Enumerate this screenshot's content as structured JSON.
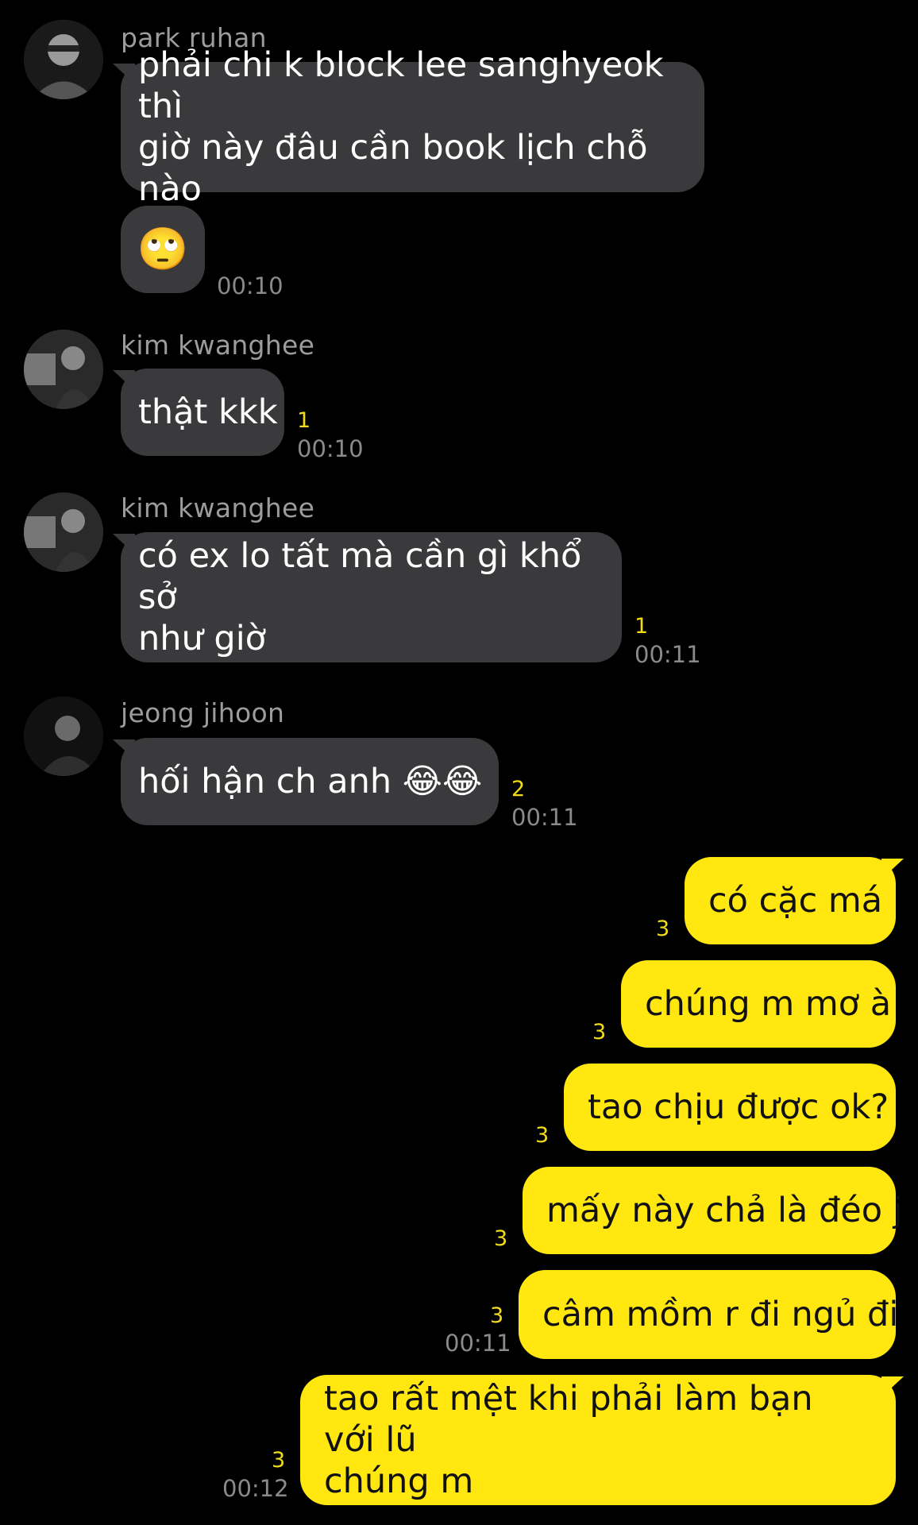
{
  "messages": [
    {
      "sender": "park ruhan",
      "text_lines": [
        "phải chi k block lee sanghyeok thì",
        "giờ này đâu cần book lịch chỗ nào"
      ]
    },
    {
      "emoji": "🙄",
      "time": "00:10"
    },
    {
      "sender": "kim kwanghee",
      "text": "thật kkk",
      "unread": "1",
      "time": "00:10"
    },
    {
      "sender": "kim kwanghee",
      "text_lines": [
        "có ex lo tất mà cần gì khổ sở",
        "như giờ"
      ],
      "unread": "1",
      "time": "00:11"
    },
    {
      "sender": "jeong jihoon",
      "text": "hối hận ch anh 😂😂",
      "unread": "2",
      "time": "00:11"
    },
    {
      "text": "có cặc má",
      "unread": "3"
    },
    {
      "text": "chúng m mơ à",
      "unread": "3"
    },
    {
      "text": "tao chịu được ok?",
      "unread": "3"
    },
    {
      "text": "mấy này chả là đéo j",
      "unread": "3"
    },
    {
      "text": "câm mồm r đi ngủ đi",
      "unread": "3",
      "time": "00:11"
    },
    {
      "text_lines": [
        "tao rất mệt khi phải làm bạn với lũ",
        "chúng m"
      ],
      "unread": "3",
      "time": "00:12"
    }
  ],
  "colors": {
    "background": "#000000",
    "incoming_bubble": "#3a3a3c",
    "outgoing_bubble": "#ffe70f",
    "unread_count": "#f2dc1a",
    "timestamp": "#8a8a8a",
    "sender_name": "#9c9c9c"
  }
}
